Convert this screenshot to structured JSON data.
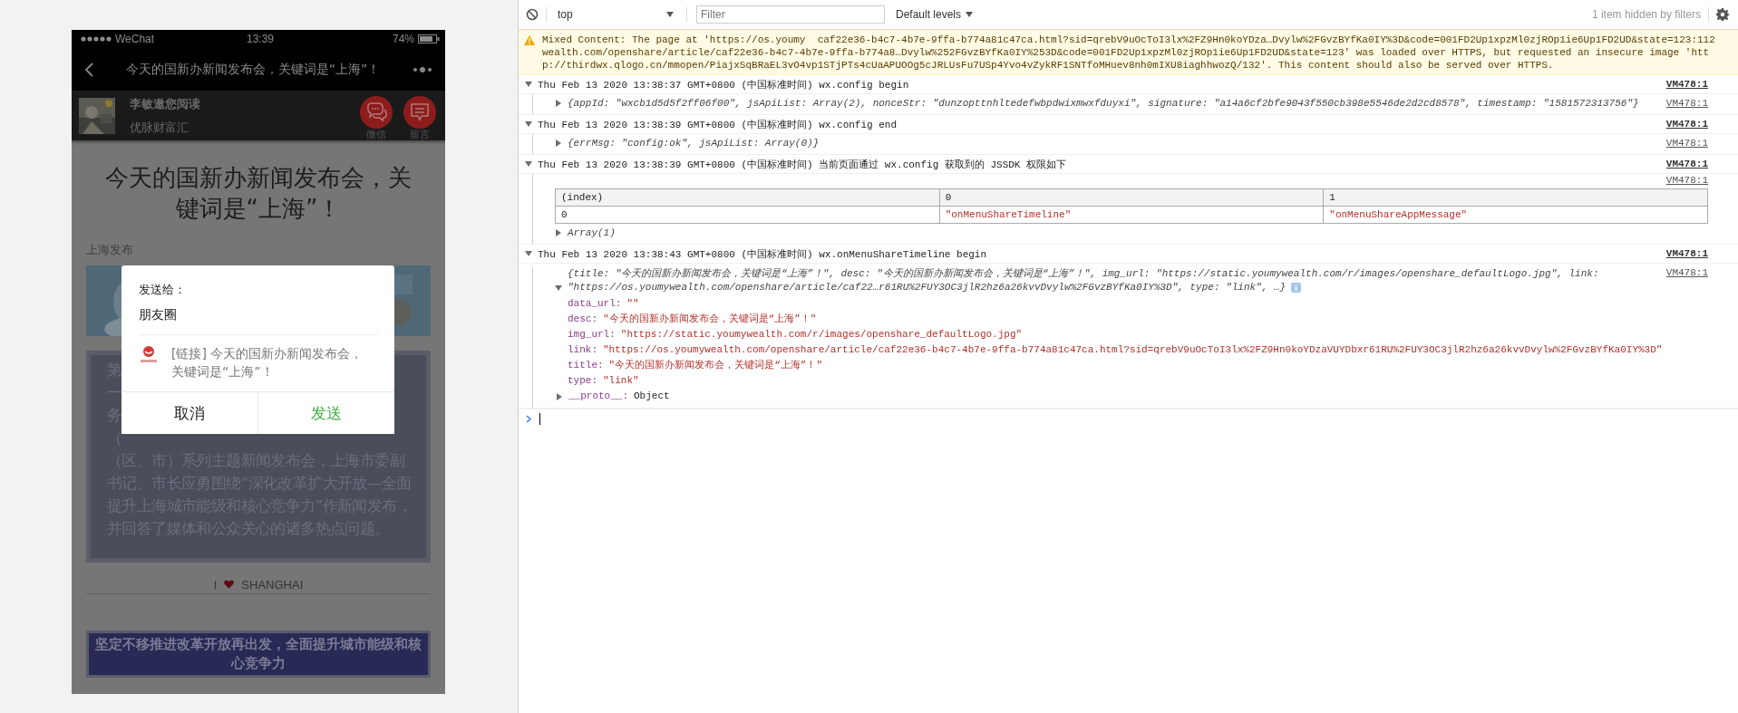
{
  "phone": {
    "status_bar": {
      "carrier": "WeChat",
      "time": "13:39",
      "battery": "74%"
    },
    "nav_bar": {
      "title": "今天的国新办新闻发布会，关键词是“上海”！"
    },
    "invite_bar": {
      "inviter": "李敏邀您阅读",
      "account": "优脉财富汇",
      "actions": [
        {
          "label": "微信",
          "kind": "chat"
        },
        {
          "label": "留言",
          "kind": "comment"
        }
      ]
    },
    "article": {
      "title": "今天的国新办新闻发布会，关键词是“上海”！",
      "source": "上海发布",
      "body_fragments": [
        "第",
        "一",
        "务",
        "（"
      ],
      "body_lines": [
        "（区、市）系列主题新闻发布会，上海市委副",
        "书记、市长应勇围绕“深化改革扩大开放—全面",
        "提升上海城市能级和核心竞争力”作新闻发布，",
        "并回答了媒体和公众关心的诸多热点问题。"
      ],
      "divider_left": "I",
      "divider_right": "SHANGHAI",
      "banner_text": "坚定不移推进改革开放再出发，全面提升城市能级和核心竞争力"
    },
    "share_dialog": {
      "label": "发送给：",
      "target": "朋友圈",
      "link_text": "[链接] 今天的国新办新闻发布会，关键词是“上海”！",
      "buttons": [
        {
          "label": "取消",
          "kind": "cancel"
        },
        {
          "label": "发送",
          "kind": "confirm"
        }
      ]
    }
  },
  "console": {
    "toolbar": {
      "context": "top",
      "filter_placeholder": "Filter",
      "levels": "Default levels",
      "hidden_note": "1 item hidden by filters"
    },
    "warning": {
      "lines": [
        "Mixed Content: The page at 'https://os.youmy  caf22e36-b4c7-4b7e-9ffa-b774a81c47ca.html?sid=qrebV9uOcToI3lx%2FZ9Hn0koYDza…Dvylw%2FGvzBYfKa0IY%3D&code=001FD2Up1xpzMl0zjROp1ie6Up1FD2UD&state=123:112",
        "wealth.com/openshare/article/caf22e36-b4c7-4b7e-9ffa-b774a8…Dvylw%252FGvzBYfKa0IY%253D&code=001FD2Up1xpzMl0zjROp1ie6Up1FD2UD&state=123' was loaded over HTTPS, but requested an insecure image 'htt",
        "p://thirdwx.qlogo.cn/mmopen/PiajxSqBRaEL3vO4vp1STjPTs4cUaAPUOOg5cJRLUsFu7USp4Yvo4vZykRF1SNTfoMHuev8nh0mIXU8iaghhwozQ/132'. This content should also be served over HTTPS."
      ]
    },
    "entries": [
      {
        "header": "Thu Feb 13 2020 13:38:37 GMT+0800 (中国标准时间) wx.config begin",
        "source": "VM478:1",
        "expanded": true,
        "children": [
          {
            "kind": "object",
            "expanded": false,
            "text": "{appId: \"wxcb1d5d5f2ff06f00\", jsApiList: Array(2), nonceStr: \"dunzopttnhltedefwbpdwixmwxfduyxi\", signature: \"a14a6cf2bfe9043f550cb398e5546de2d2cd8578\", timestamp: \"1581572313756\"}",
            "source": "VM478:1"
          }
        ]
      },
      {
        "header": "Thu Feb 13 2020 13:38:39 GMT+0800 (中国标准时间) wx.config end",
        "source": "VM478:1",
        "expanded": true,
        "children": [
          {
            "kind": "object",
            "expanded": false,
            "text": "{errMsg: \"config:ok\", jsApiList: Array(0)}",
            "source": "VM478:1"
          }
        ]
      },
      {
        "header": "Thu Feb 13 2020 13:38:39 GMT+0800 (中国标准时间) 当前页面通过 wx.config 获取到的 JSSDK 权限如下",
        "source": "VM478:1",
        "expanded": true,
        "children": [
          {
            "kind": "table",
            "source": "VM478:1",
            "columns": [
              "(index)",
              "0",
              "1"
            ],
            "rows": [
              [
                "0",
                "\"onMenuShareTimeline\"",
                "\"onMenuShareAppMessage\""
              ]
            ]
          },
          {
            "kind": "object",
            "expanded": false,
            "text": "Array(1)"
          }
        ]
      },
      {
        "header": "Thu Feb 13 2020 13:38:43 GMT+0800 (中国标准时间) wx.onMenuShareTimeline begin",
        "source": "VM478:1",
        "expanded": true,
        "children": [
          {
            "kind": "tree",
            "expanded": true,
            "source": "VM478:1",
            "preview_lines": [
              "{title: \"今天的国新办新闻发布会，关键词是“上海”！\", desc: \"今天的国新办新闻发布会，关键词是“上海”！\", img_url: \"https://static.youmywealth.com/r/images/openshare_defaultLogo.jpg\", link:",
              "\"https://os.youmywealth.com/openshare/article/caf22…r61RU%2FUY3OC3jlR2hz6a26kvvDvylw%2FGvzBYfKa0IY%3D\", type: \"link\", …}"
            ],
            "properties": [
              {
                "key": "data_url:",
                "value": "\"\""
              },
              {
                "key": "desc:",
                "value": "\"今天的国新办新闻发布会，关键词是“上海”！\""
              },
              {
                "key": "img_url:",
                "value": "\"https://static.youmywealth.com/r/images/openshare_defaultLogo.jpg\""
              },
              {
                "key": "link:",
                "value": "\"https://os.youmywealth.com/openshare/article/caf22e36-b4c7-4b7e-9ffa-b774a81c47ca.html?sid=qrebV9uOcToI3lx%2FZ9Hn0koYDzaVUYDbxr61RU%2FUY3OC3jlR2hz6a26kvvDvylw%2FGvzBYfKa0IY%3D\""
              },
              {
                "key": "title:",
                "value": "\"今天的国新办新闻发布会，关键词是“上海”！\""
              },
              {
                "key": "type:",
                "value": "\"link\""
              }
            ],
            "proto": {
              "key": "__proto__:",
              "value": "Object",
              "expanded": false
            }
          }
        ]
      }
    ]
  }
}
